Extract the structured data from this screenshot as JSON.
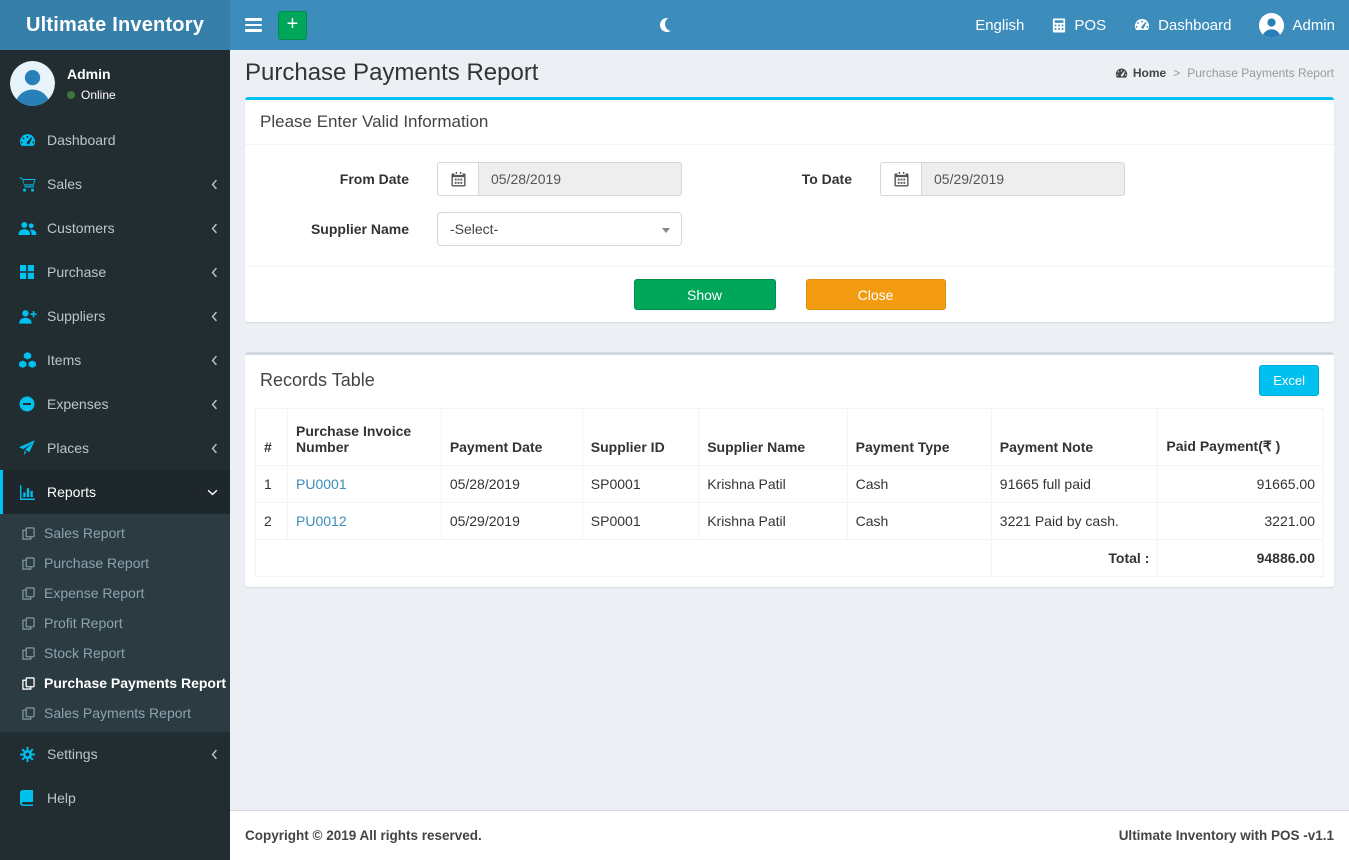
{
  "colors": {
    "navbar_bg": "#3c8dbc",
    "logo_bg": "#367fa9",
    "sidebar_bg": "#222d32",
    "submenu_bg": "#2c3b41",
    "accent_cyan": "#00c0ef",
    "button_green": "#00a65a",
    "button_orange": "#f39c12",
    "link_blue": "#3c8dbc",
    "online_green": "#3c763d",
    "content_bg": "#ecf0f5"
  },
  "navbar": {
    "brand": "Ultimate Inventory",
    "language": "English",
    "pos_label": "POS",
    "dashboard_label": "Dashboard",
    "user_label": "Admin"
  },
  "sidebar": {
    "user_name": "Admin",
    "user_status": "Online",
    "items": [
      {
        "label": "Dashboard",
        "icon": "tachometer-icon"
      },
      {
        "label": "Sales",
        "icon": "cart-icon"
      },
      {
        "label": "Customers",
        "icon": "users-icon"
      },
      {
        "label": "Purchase",
        "icon": "grid-icon"
      },
      {
        "label": "Suppliers",
        "icon": "user-plus-icon"
      },
      {
        "label": "Items",
        "icon": "cubes-icon"
      },
      {
        "label": "Expenses",
        "icon": "minus-circle-icon"
      },
      {
        "label": "Places",
        "icon": "paper-plane-icon"
      },
      {
        "label": "Reports",
        "icon": "bar-chart-icon"
      }
    ],
    "reports_submenu": [
      {
        "label": "Sales Report"
      },
      {
        "label": "Purchase Report"
      },
      {
        "label": "Expense Report"
      },
      {
        "label": "Profit Report"
      },
      {
        "label": "Stock Report"
      },
      {
        "label": "Purchase Payments Report"
      },
      {
        "label": "Sales Payments Report"
      }
    ],
    "settings_label": "Settings",
    "help_label": "Help"
  },
  "page": {
    "title": "Purchase Payments Report",
    "breadcrumb": {
      "home": "Home",
      "separator": ">",
      "current": "Purchase Payments Report"
    }
  },
  "filter": {
    "title": "Please Enter Valid Information",
    "from_date_label": "From Date",
    "from_date_value": "05/28/2019",
    "to_date_label": "To Date",
    "to_date_value": "05/29/2019",
    "supplier_label": "Supplier Name",
    "supplier_value": "-Select-",
    "show_button": "Show",
    "close_button": "Close"
  },
  "records": {
    "title": "Records Table",
    "excel_button": "Excel",
    "columns": [
      "#",
      "Purchase Invoice Number",
      "Payment Date",
      "Supplier ID",
      "Supplier Name",
      "Payment Type",
      "Payment Note",
      "Paid Payment(₹ )"
    ],
    "rows": [
      {
        "num": "1",
        "invoice": "PU0001",
        "payment_date": "05/28/2019",
        "supplier_id": "SP0001",
        "supplier_name": "Krishna Patil",
        "payment_type": "Cash",
        "payment_note": "91665 full paid",
        "paid_payment": "91665.00"
      },
      {
        "num": "2",
        "invoice": "PU0012",
        "payment_date": "05/29/2019",
        "supplier_id": "SP0001",
        "supplier_name": "Krishna Patil",
        "payment_type": "Cash",
        "payment_note": "3221 Paid by cash.",
        "paid_payment": "3221.00"
      }
    ],
    "total_label": "Total :",
    "total_value": "94886.00"
  },
  "footer": {
    "left": "Copyright © 2019 All rights reserved.",
    "right": "Ultimate Inventory with POS -v1.1"
  }
}
